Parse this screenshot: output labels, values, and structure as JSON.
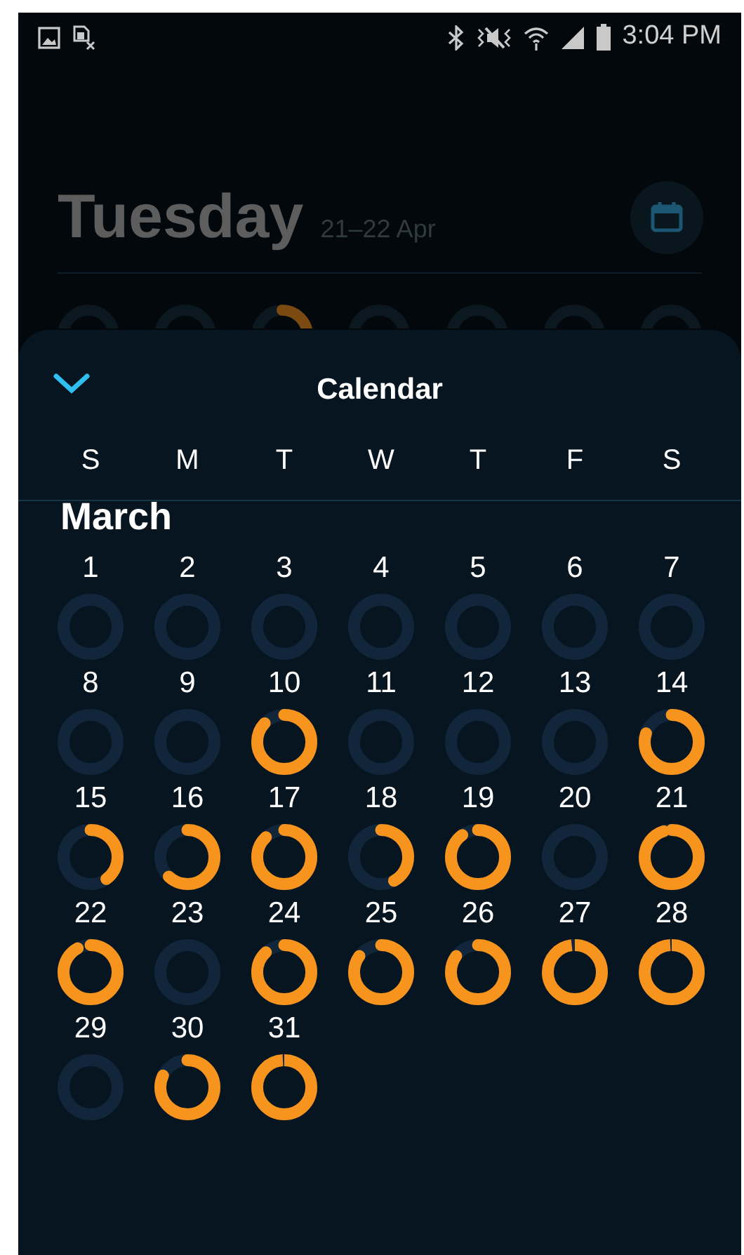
{
  "status_bar": {
    "time": "3:04 PM"
  },
  "background": {
    "day": "Tuesday",
    "date_range": "21–22 Apr"
  },
  "sheet": {
    "title": "Calendar",
    "weekdays": [
      "S",
      "M",
      "T",
      "W",
      "T",
      "F",
      "S"
    ],
    "month": "March",
    "days": [
      {
        "label": "1"
      },
      {
        "label": "2"
      },
      {
        "label": "3"
      },
      {
        "label": "4"
      },
      {
        "label": "5"
      },
      {
        "label": "6"
      },
      {
        "label": "7"
      },
      {
        "label": "8"
      },
      {
        "label": "9"
      },
      {
        "label": "10"
      },
      {
        "label": "11"
      },
      {
        "label": "12"
      },
      {
        "label": "13"
      },
      {
        "label": "14"
      },
      {
        "label": "15"
      },
      {
        "label": "16"
      },
      {
        "label": "17"
      },
      {
        "label": "18"
      },
      {
        "label": "19"
      },
      {
        "label": "20"
      },
      {
        "label": "21"
      },
      {
        "label": "22"
      },
      {
        "label": "23"
      },
      {
        "label": "24"
      },
      {
        "label": "25"
      },
      {
        "label": "26"
      },
      {
        "label": "27"
      },
      {
        "label": "28"
      },
      {
        "label": "29"
      },
      {
        "label": "30"
      },
      {
        "label": "31"
      }
    ]
  }
}
